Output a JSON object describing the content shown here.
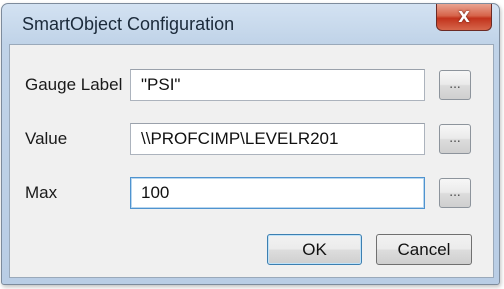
{
  "window": {
    "title": "SmartObject Configuration",
    "close_label": "X"
  },
  "fields": [
    {
      "label": "Gauge Label",
      "value": "\"PSI\"",
      "browse_label": "..."
    },
    {
      "label": "Value",
      "value": "\\\\PROFCIMP\\LEVELR201",
      "browse_label": "..."
    },
    {
      "label": "Max",
      "value": "100",
      "browse_label": "..."
    }
  ],
  "buttons": {
    "ok_label": "OK",
    "cancel_label": "Cancel"
  },
  "colors": {
    "window_frame": "#c0d3e8",
    "client_background": "#f0f0f0",
    "close_button": "#c2331c",
    "focus_border": "#4f93cf"
  }
}
